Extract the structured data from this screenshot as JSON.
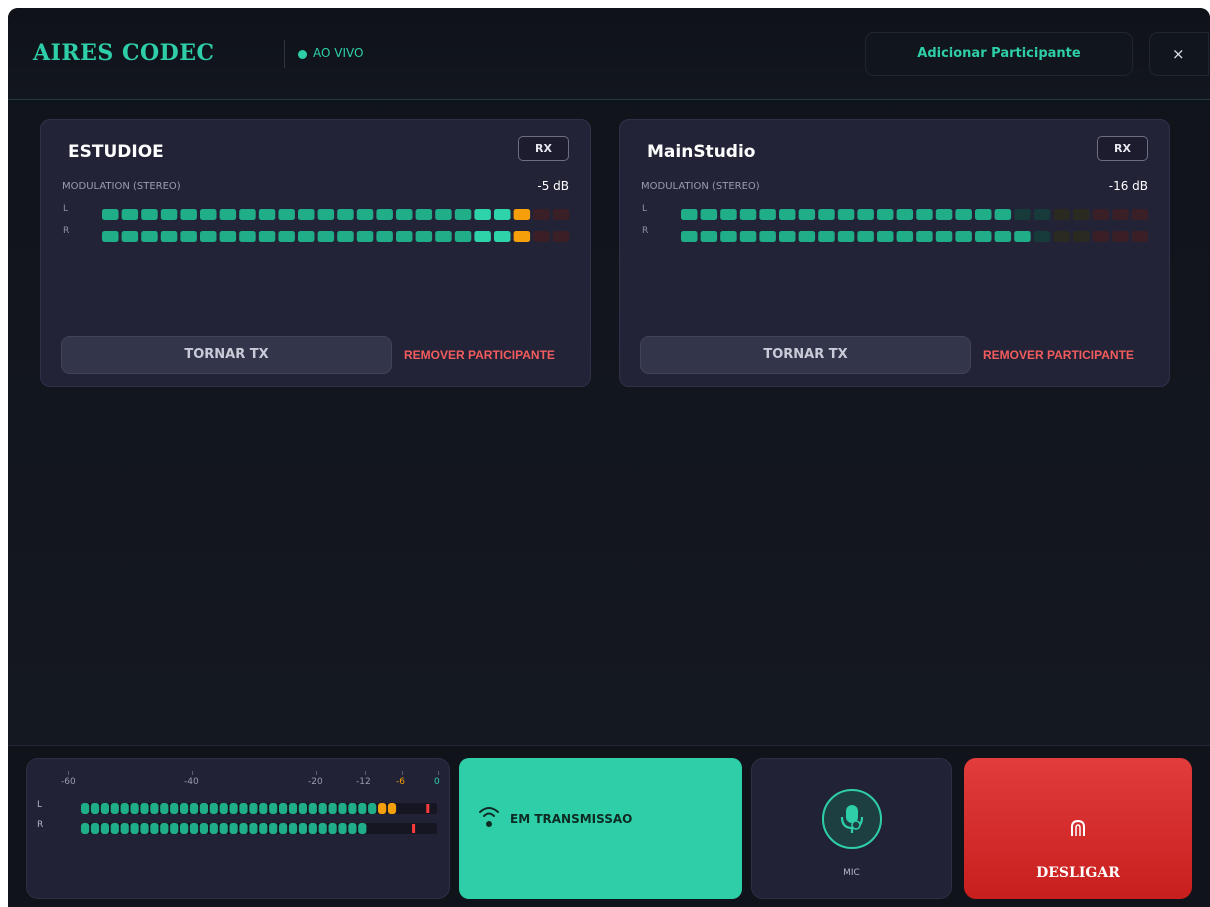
{
  "header": {
    "title": "AIRES CODEC",
    "status": "AO VIVO",
    "add_participant": "Adicionar Participante",
    "close": "×"
  },
  "participants": [
    {
      "name": "ESTUDIOE",
      "badge": "RX",
      "modulation_label": "MODULATION (STEREO)",
      "level": "-5 dB",
      "left_label": "L",
      "right_label": "R",
      "left_lit": 22,
      "right_lit": 22,
      "tx_button": "TORNAR TX",
      "remove_button": "REMOVER PARTICIPANTE"
    },
    {
      "name": "MainStudio",
      "badge": "RX",
      "modulation_label": "MODULATION (STEREO)",
      "level": "-16 dB",
      "left_label": "L",
      "right_label": "R",
      "left_lit": 17,
      "right_lit": 18,
      "tx_button": "TORNAR TX",
      "remove_button": "REMOVER PARTICIPANTE"
    }
  ],
  "master_meter": {
    "scale": [
      "-60",
      "-40",
      "-20",
      "-12",
      "-6",
      "0"
    ],
    "left_label": "L",
    "right_label": "R",
    "left_lit": 32,
    "right_lit": 29,
    "left_peak": 0.97,
    "right_peak": 0.93
  },
  "transmission": {
    "label": "EM TRANSMISSAO"
  },
  "mic": {
    "label": "MIC"
  },
  "hangup": {
    "label": "DESLIGAR"
  },
  "colors": {
    "accent": "#2ecfa8",
    "segment_green": "#1fae88",
    "segment_bright": "#2ed3aa",
    "segment_orange": "#f5a00b",
    "danger": "#e23c3c"
  }
}
